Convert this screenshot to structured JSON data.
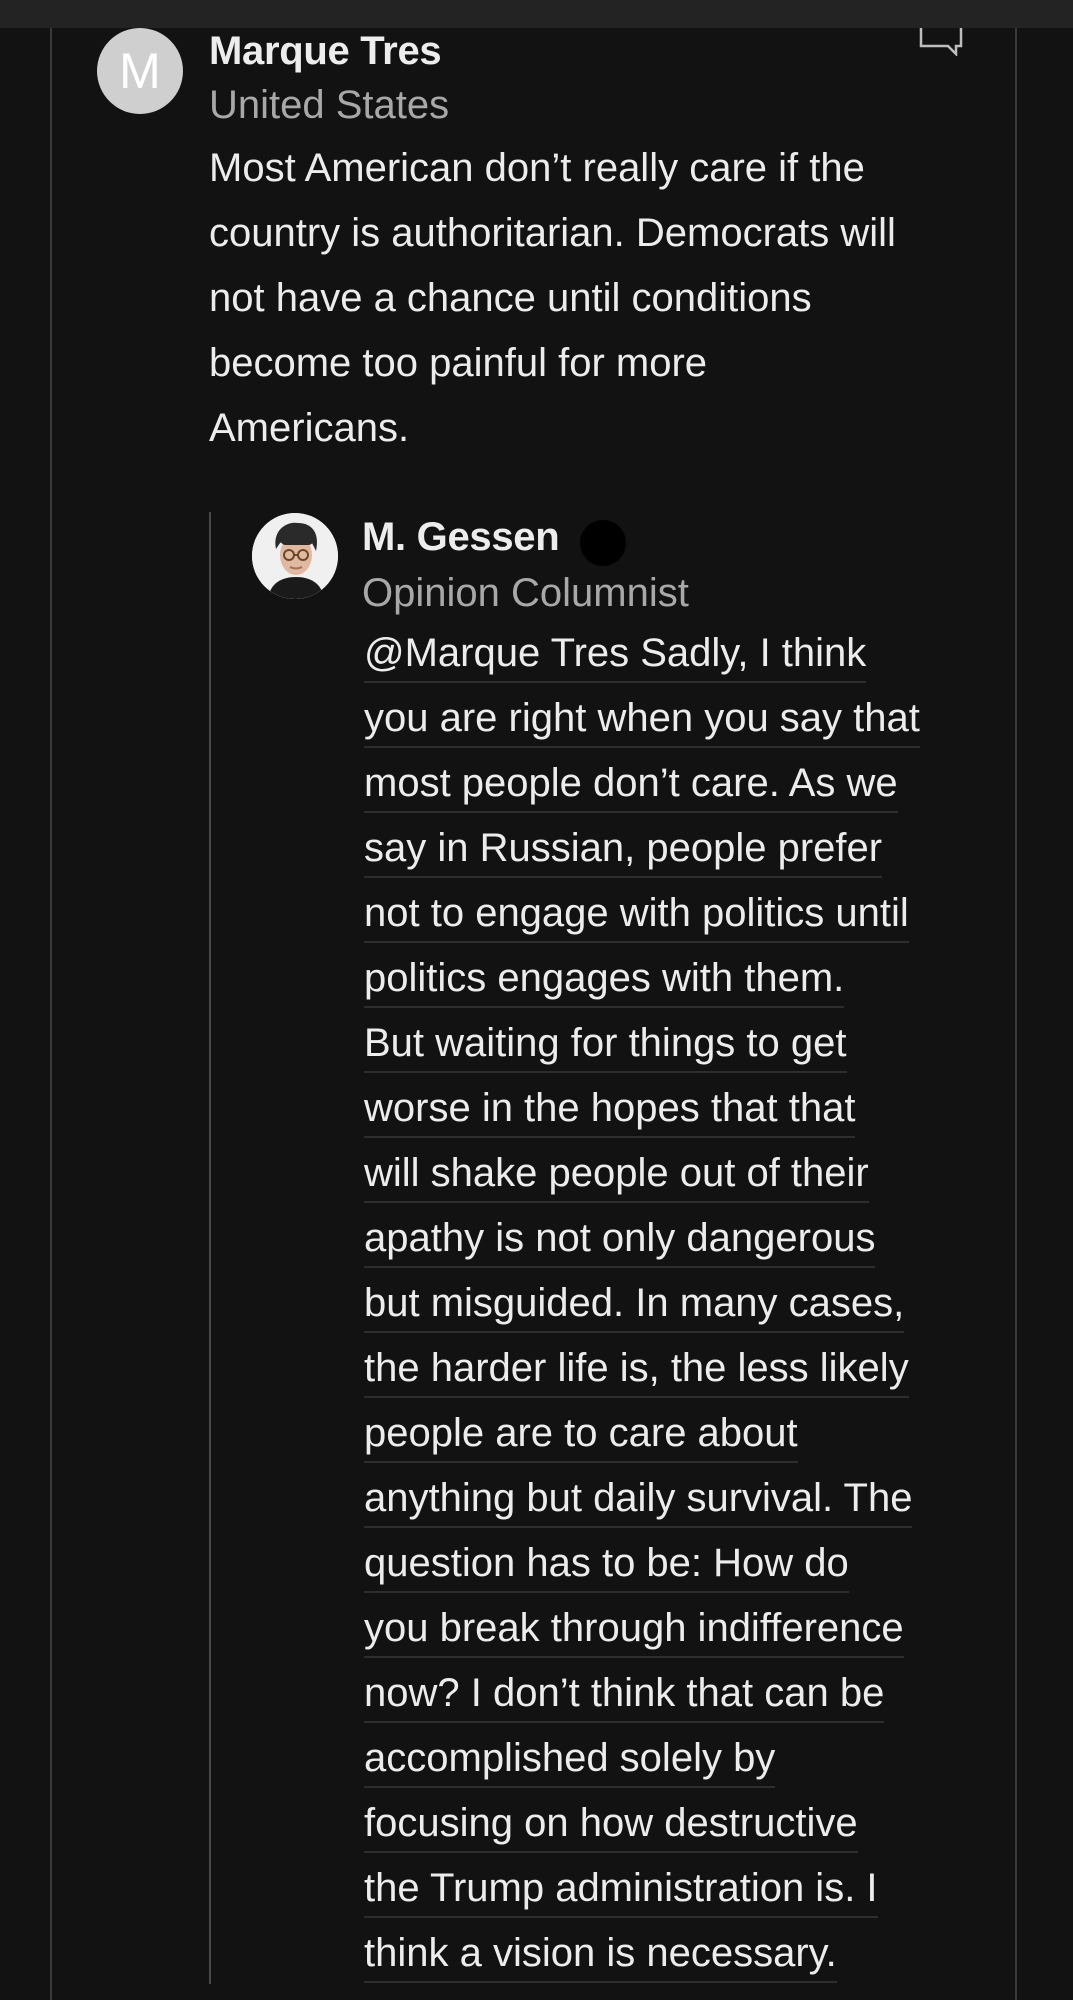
{
  "comment": {
    "avatar_letter": "M",
    "author": "Marque Tres",
    "location": "United States",
    "body_lines": [
      "Most American don’t really care if the",
      "country is authoritarian. Democrats will",
      "not have a chance until conditions",
      "become too painful for more",
      "Americans."
    ]
  },
  "reply": {
    "author": "M. Gessen",
    "role": "Opinion Columnist",
    "body_lines": [
      "@Marque Tres Sadly, I think",
      "you are right when you say that",
      "most people don’t care. As we",
      "say in Russian, people prefer",
      "not to engage with politics until",
      "politics engages with them.",
      "But waiting for things to get",
      "worse in the hopes that that",
      "will shake people out of their",
      "apathy is not only dangerous",
      "but misguided. In many cases,",
      "the harder life is, the less likely",
      "people are to care about",
      "anything but daily survival. The",
      "question has to be: How do",
      "you break through indifference",
      "now? I don’t think that can be",
      "accomplished solely by",
      "focusing on how destructive",
      "the Trump administration is. I",
      "think a vision is necessary."
    ]
  },
  "icons": {
    "reply_flag": "reply-flag-icon",
    "verified": "verified-badge-icon"
  },
  "colors": {
    "background": "#121212",
    "text": "#ececec",
    "muted": "#a8a8a8"
  }
}
